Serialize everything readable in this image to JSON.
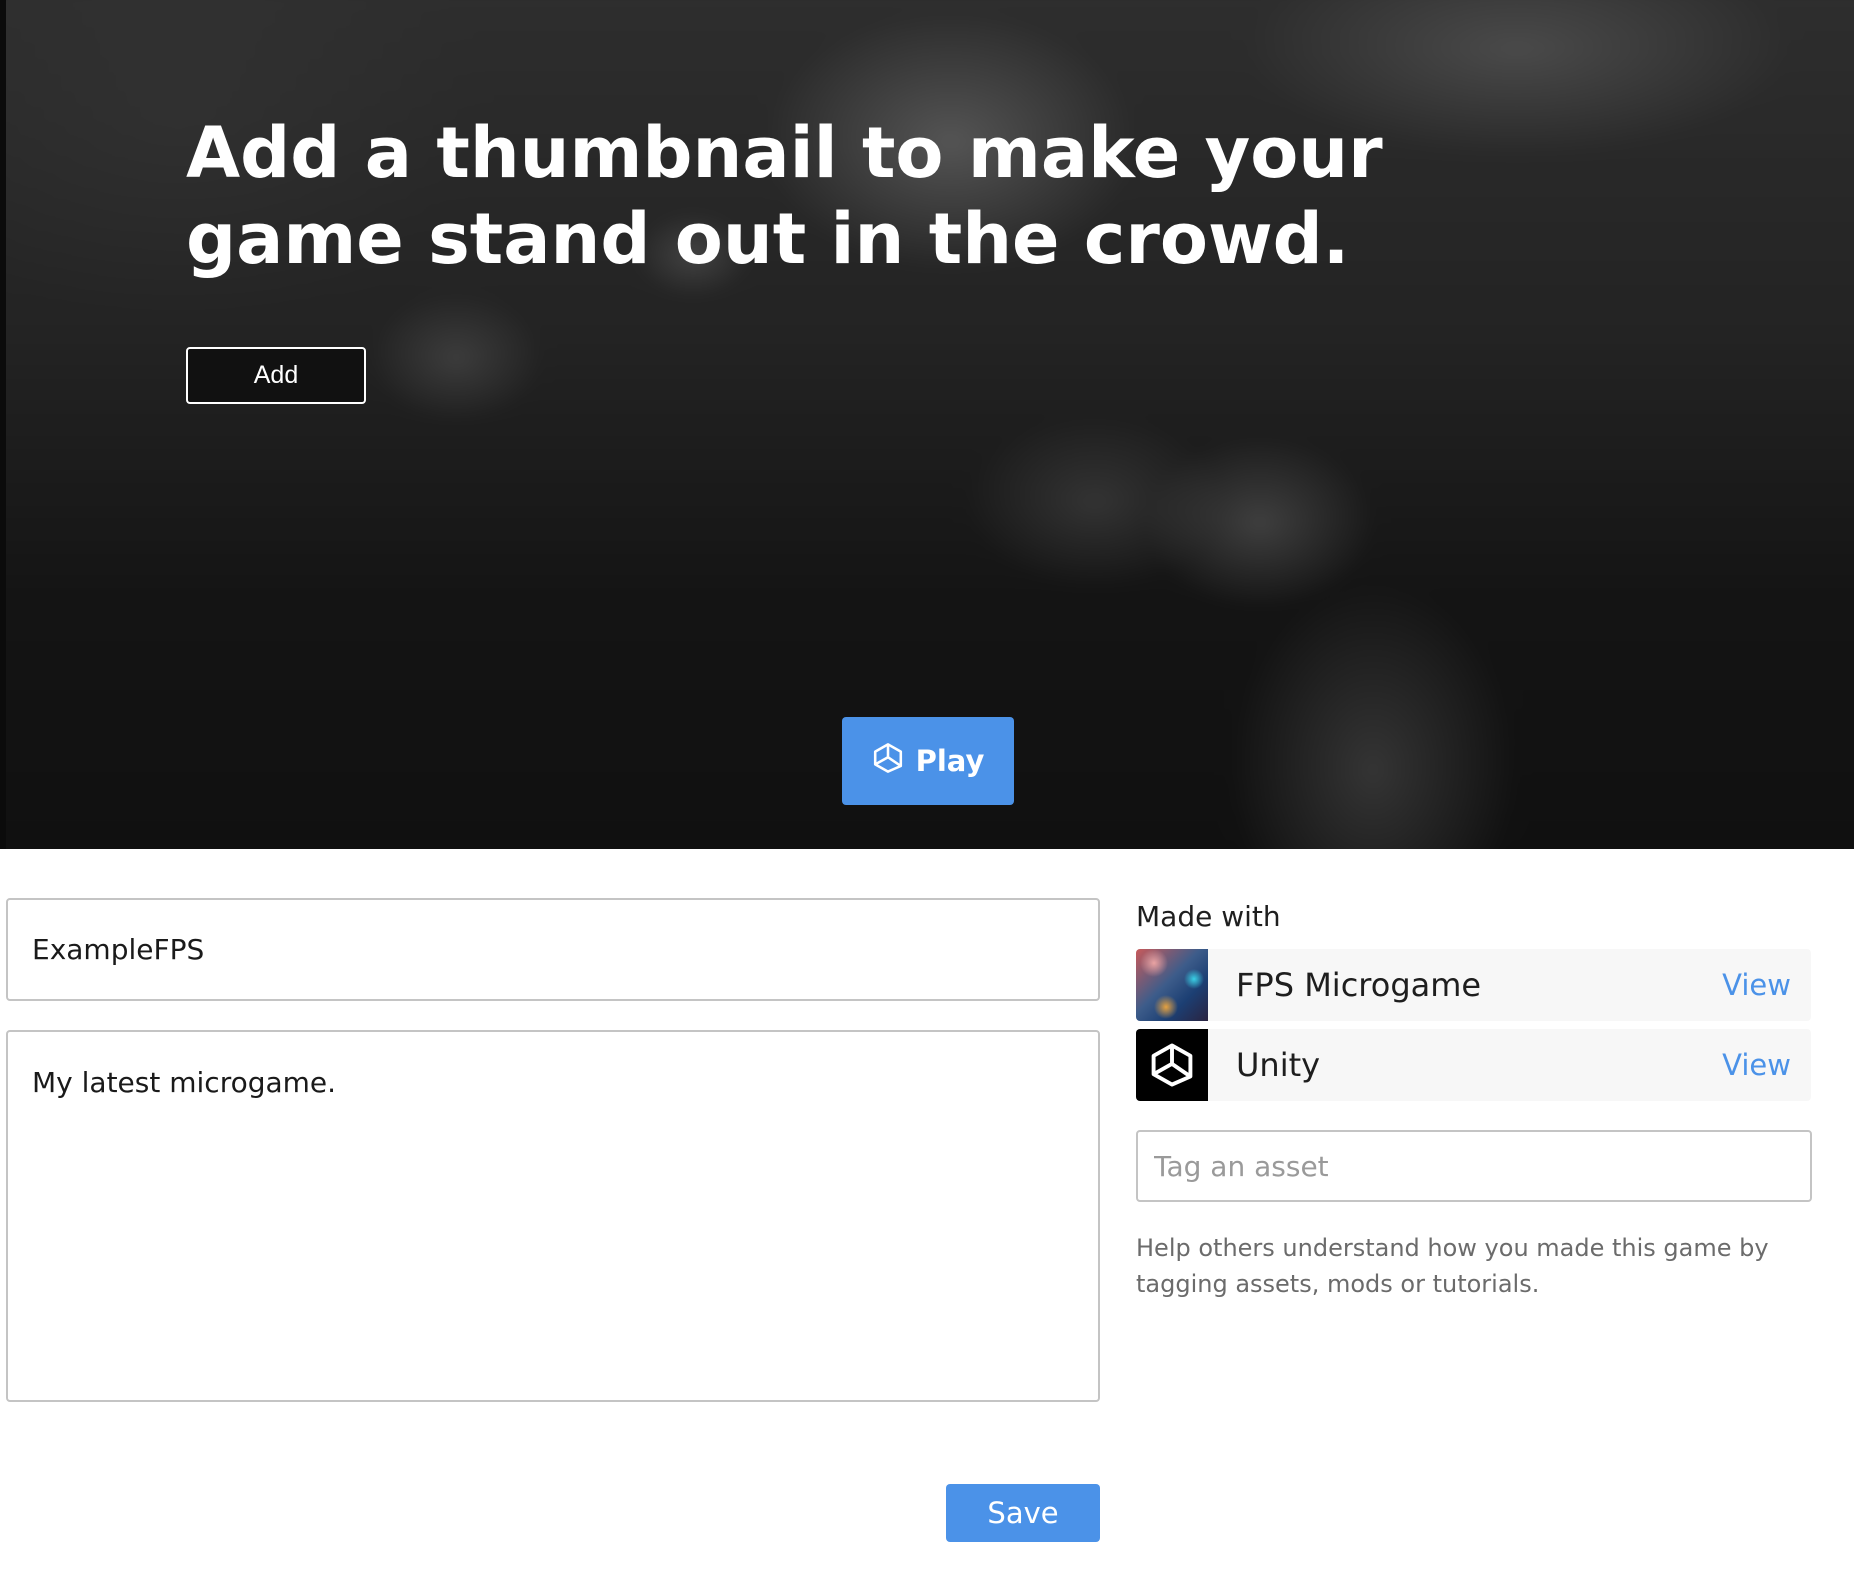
{
  "hero": {
    "title": "Add a thumbnail to make your game stand out in the crowd.",
    "add_label": "Add",
    "play_label": "Play"
  },
  "form": {
    "title_value": "ExampleFPS",
    "description_value": "My latest microgame.",
    "save_label": "Save"
  },
  "made_with": {
    "label": "Made with",
    "items": [
      {
        "name": "FPS Microgame",
        "action": "View",
        "thumb_icon": "fps-microgame-thumbnail"
      },
      {
        "name": "Unity",
        "action": "View",
        "thumb_icon": "unity-logo-icon"
      }
    ],
    "tag_placeholder": "Tag an asset",
    "help_text": "Help others understand how you made this game by tagging assets, mods or tutorials."
  },
  "colors": {
    "accent": "#4b92e8",
    "hero_background": "#161616"
  }
}
